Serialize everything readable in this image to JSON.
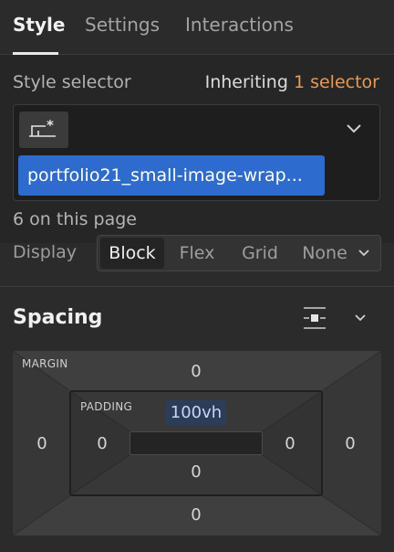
{
  "tabs": [
    {
      "label": "Style",
      "active": true
    },
    {
      "label": "Settings",
      "active": false
    },
    {
      "label": "Interactions",
      "active": false
    }
  ],
  "style_selector": {
    "label": "Style selector",
    "inheriting_prefix": "Inheriting",
    "inheriting_link": "1 selector",
    "selected_class": "portfolio21_small-image-wrap...",
    "page_count": "6 on this page"
  },
  "display": {
    "label": "Display",
    "options": [
      "Block",
      "Flex",
      "Grid",
      "None"
    ],
    "selected": "Block"
  },
  "spacing": {
    "title": "Spacing",
    "margin_label": "MARGIN",
    "padding_label": "PADDING",
    "margin": {
      "top": "0",
      "right": "0",
      "bottom": "0",
      "left": "0"
    },
    "padding": {
      "top": "100vh",
      "right": "0",
      "bottom": "0",
      "left": "0"
    }
  },
  "colors": {
    "accent": "#e89a55",
    "selection": "#2e6bcf",
    "panel": "#2b2b2b"
  },
  "icons": {
    "selector_tag": "element-star-icon",
    "dropdown": "chevron-down-icon",
    "spacing_toggle": "spacing-center-icon"
  }
}
